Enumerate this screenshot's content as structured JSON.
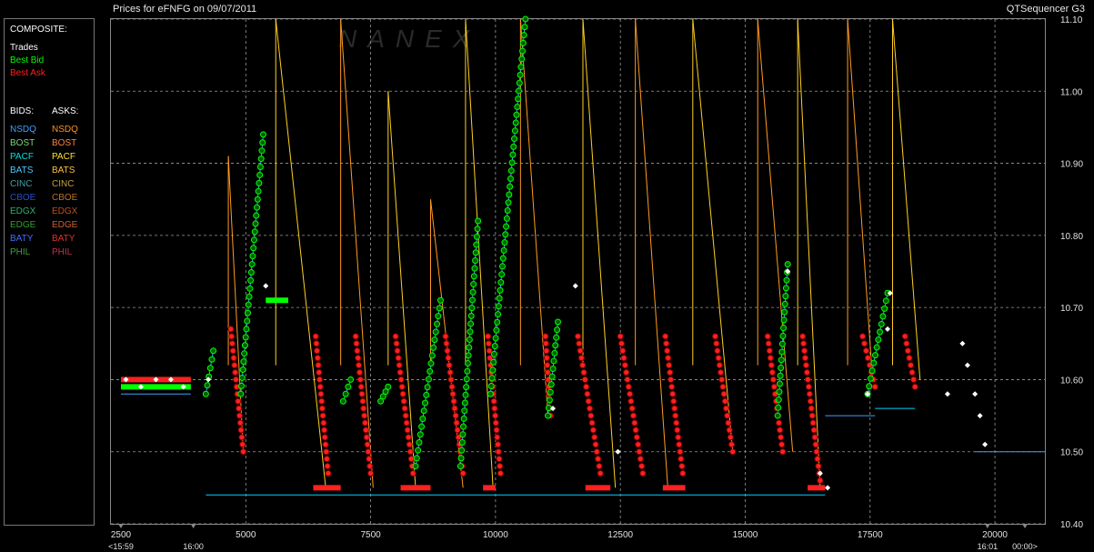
{
  "header": {
    "title_left": "Prices for  eFNFG  on  09/07/2011",
    "title_right": "QTSequencer G3"
  },
  "legend": {
    "composite_label": "COMPOSITE:",
    "composite_items": [
      {
        "label": "Trades",
        "color": "#ffffff"
      },
      {
        "label": "Best Bid",
        "color": "#00ff00"
      },
      {
        "label": "Best Ask",
        "color": "#ff2020"
      }
    ],
    "bids_label": "BIDS:",
    "asks_label": "ASKS:",
    "bids": [
      {
        "label": "NSDQ",
        "color": "#3fa0ff"
      },
      {
        "label": "BOST",
        "color": "#7cd67c"
      },
      {
        "label": "PACF",
        "color": "#00e0e0"
      },
      {
        "label": "BATS",
        "color": "#4fc8ff"
      },
      {
        "label": "CINC",
        "color": "#40a0a0"
      },
      {
        "label": "CBOE",
        "color": "#2050d0"
      },
      {
        "label": "EDGX",
        "color": "#30b070"
      },
      {
        "label": "EDGE",
        "color": "#30a030"
      },
      {
        "label": "BATY",
        "color": "#4070ff"
      },
      {
        "label": "PHIL",
        "color": "#40a040"
      }
    ],
    "asks": [
      {
        "label": "NSDQ",
        "color": "#ff9020"
      },
      {
        "label": "BOST",
        "color": "#ff8040"
      },
      {
        "label": "PACF",
        "color": "#ffe020"
      },
      {
        "label": "BATS",
        "color": "#ffc040"
      },
      {
        "label": "CINC",
        "color": "#c0a040"
      },
      {
        "label": "CBOE",
        "color": "#c07020"
      },
      {
        "label": "EDGX",
        "color": "#c05020"
      },
      {
        "label": "EDGE",
        "color": "#d06030"
      },
      {
        "label": "BATY",
        "color": "#e03030"
      },
      {
        "label": "PHIL",
        "color": "#c03050"
      }
    ]
  },
  "watermark": "NANEX",
  "chart_data": {
    "type": "line",
    "title": "Prices for  eFNFG  on  09/07/2011",
    "xlim": [
      2300,
      21000
    ],
    "ylim": [
      10.4,
      11.1
    ],
    "x_ticks": [
      2500,
      5000,
      7500,
      10000,
      12500,
      15000,
      17500,
      20000
    ],
    "y_ticks": [
      10.4,
      10.5,
      10.6,
      10.7,
      10.8,
      10.9,
      11.0,
      11.1
    ],
    "y_tick_labels": [
      "10.40",
      "10.50",
      "10.60",
      "10.70",
      "10.80",
      "10.90",
      "11.00",
      "11.10"
    ],
    "time_markers": [
      {
        "x": 2500,
        "label": "<15:59"
      },
      {
        "x": 3950,
        "label": "16:00"
      },
      {
        "x": 19850,
        "label": "16:01"
      },
      {
        "x": 20600,
        "label": "00:00>"
      }
    ],
    "grid": true,
    "grid_style": "dashed",
    "colors": {
      "trades": "#ffffff",
      "best_bid": "#00ff00",
      "best_ask": "#ff2020",
      "ask_orange": "#ff9a20",
      "ask_yellow": "#ffd020",
      "bid_blue": "#3fa0ff",
      "bid_cyan": "#00d0ff"
    },
    "ask_sawtooth": [
      {
        "x0": 4650,
        "y0": 10.91,
        "x1": 4950,
        "y1": 10.5
      },
      {
        "x0": 5600,
        "y0": 11.1,
        "x1": 6600,
        "y1": 10.45
      },
      {
        "x0": 6900,
        "y0": 11.1,
        "x1": 7550,
        "y1": 10.45
      },
      {
        "x0": 7850,
        "y0": 11.0,
        "x1": 8400,
        "y1": 10.45
      },
      {
        "x0": 8700,
        "y0": 10.85,
        "x1": 9350,
        "y1": 10.45
      },
      {
        "x0": 9400,
        "y0": 11.1,
        "x1": 9950,
        "y1": 10.45
      },
      {
        "x0": 10500,
        "y0": 11.1,
        "x1": 11050,
        "y1": 10.55
      },
      {
        "x0": 11750,
        "y0": 11.1,
        "x1": 12400,
        "y1": 10.45
      },
      {
        "x0": 12800,
        "y0": 11.1,
        "x1": 13450,
        "y1": 10.45
      },
      {
        "x0": 13950,
        "y0": 11.1,
        "x1": 14750,
        "y1": 10.5
      },
      {
        "x0": 15250,
        "y0": 11.1,
        "x1": 15950,
        "y1": 10.5
      },
      {
        "x0": 16050,
        "y0": 11.1,
        "x1": 16500,
        "y1": 10.45
      },
      {
        "x0": 17050,
        "y0": 11.1,
        "x1": 17550,
        "y1": 10.6
      },
      {
        "x0": 17950,
        "y0": 11.1,
        "x1": 18500,
        "y1": 10.6
      }
    ],
    "best_ask_trails": [
      {
        "x0": 4700,
        "y0": 10.67,
        "x1": 4950,
        "y1": 10.5
      },
      {
        "x0": 6400,
        "y0": 10.66,
        "x1": 6650,
        "y1": 10.47
      },
      {
        "x0": 7200,
        "y0": 10.66,
        "x1": 7500,
        "y1": 10.47
      },
      {
        "x0": 8000,
        "y0": 10.66,
        "x1": 8350,
        "y1": 10.47
      },
      {
        "x0": 9000,
        "y0": 10.66,
        "x1": 9350,
        "y1": 10.47
      },
      {
        "x0": 9850,
        "y0": 10.66,
        "x1": 10100,
        "y1": 10.47
      },
      {
        "x0": 11000,
        "y0": 10.66,
        "x1": 11100,
        "y1": 10.55
      },
      {
        "x0": 11650,
        "y0": 10.66,
        "x1": 12100,
        "y1": 10.47
      },
      {
        "x0": 12500,
        "y0": 10.66,
        "x1": 12950,
        "y1": 10.47
      },
      {
        "x0": 13400,
        "y0": 10.66,
        "x1": 13750,
        "y1": 10.47
      },
      {
        "x0": 14400,
        "y0": 10.66,
        "x1": 14750,
        "y1": 10.5
      },
      {
        "x0": 15450,
        "y0": 10.66,
        "x1": 15750,
        "y1": 10.5
      },
      {
        "x0": 16150,
        "y0": 10.66,
        "x1": 16500,
        "y1": 10.46
      },
      {
        "x0": 17350,
        "y0": 10.66,
        "x1": 17600,
        "y1": 10.59
      },
      {
        "x0": 18200,
        "y0": 10.66,
        "x1": 18400,
        "y1": 10.59
      }
    ],
    "best_bid_ramps": [
      {
        "x0": 4200,
        "y0": 10.58,
        "x1": 4350,
        "y1": 10.64
      },
      {
        "x0": 4900,
        "y0": 10.58,
        "x1": 5350,
        "y1": 10.94
      },
      {
        "x0": 6950,
        "y0": 10.57,
        "x1": 7100,
        "y1": 10.6
      },
      {
        "x0": 7700,
        "y0": 10.57,
        "x1": 7850,
        "y1": 10.59
      },
      {
        "x0": 8400,
        "y0": 10.48,
        "x1": 8900,
        "y1": 10.71
      },
      {
        "x0": 9300,
        "y0": 10.48,
        "x1": 9650,
        "y1": 10.82
      },
      {
        "x0": 9900,
        "y0": 10.58,
        "x1": 10600,
        "y1": 11.1
      },
      {
        "x0": 11050,
        "y0": 10.55,
        "x1": 11250,
        "y1": 10.68
      },
      {
        "x0": 15650,
        "y0": 10.55,
        "x1": 15850,
        "y1": 10.76
      },
      {
        "x0": 17450,
        "y0": 10.58,
        "x1": 17850,
        "y1": 10.72
      }
    ],
    "best_bid_flats": [
      {
        "x0": 2500,
        "x1": 3900,
        "y": 10.59
      },
      {
        "x0": 5400,
        "x1": 5850,
        "y": 10.71
      }
    ],
    "best_ask_flats": [
      {
        "x0": 2500,
        "x1": 3900,
        "y": 10.6
      },
      {
        "x0": 6350,
        "x1": 6900,
        "y": 10.45
      },
      {
        "x0": 8100,
        "x1": 8700,
        "y": 10.45
      },
      {
        "x0": 9750,
        "x1": 10000,
        "y": 10.45
      },
      {
        "x0": 11800,
        "x1": 12300,
        "y": 10.45
      },
      {
        "x0": 13350,
        "x1": 13800,
        "y": 10.45
      },
      {
        "x0": 16250,
        "x1": 16600,
        "y": 10.45
      }
    ],
    "bid_steps": [
      {
        "x0": 2500,
        "x1": 3900,
        "y": 10.58
      },
      {
        "x0": 4200,
        "x1": 16600,
        "y": 10.44
      },
      {
        "x0": 16600,
        "x1": 17600,
        "y": 10.55
      },
      {
        "x0": 17600,
        "x1": 18400,
        "y": 10.56
      },
      {
        "x0": 19600,
        "x1": 21000,
        "y": 10.5
      }
    ],
    "trades": [
      {
        "x": 2600,
        "y": 10.6
      },
      {
        "x": 2900,
        "y": 10.59
      },
      {
        "x": 3200,
        "y": 10.6
      },
      {
        "x": 3500,
        "y": 10.6
      },
      {
        "x": 3750,
        "y": 10.59
      },
      {
        "x": 4250,
        "y": 10.6
      },
      {
        "x": 5400,
        "y": 10.73
      },
      {
        "x": 11150,
        "y": 10.56
      },
      {
        "x": 11600,
        "y": 10.73
      },
      {
        "x": 12450,
        "y": 10.5
      },
      {
        "x": 15850,
        "y": 10.75
      },
      {
        "x": 16500,
        "y": 10.47
      },
      {
        "x": 16650,
        "y": 10.45
      },
      {
        "x": 17450,
        "y": 10.58
      },
      {
        "x": 17850,
        "y": 10.67
      },
      {
        "x": 17900,
        "y": 10.72
      },
      {
        "x": 19050,
        "y": 10.58
      },
      {
        "x": 19350,
        "y": 10.65
      },
      {
        "x": 19450,
        "y": 10.62
      },
      {
        "x": 19600,
        "y": 10.58
      },
      {
        "x": 19700,
        "y": 10.55
      },
      {
        "x": 19800,
        "y": 10.51
      }
    ]
  }
}
